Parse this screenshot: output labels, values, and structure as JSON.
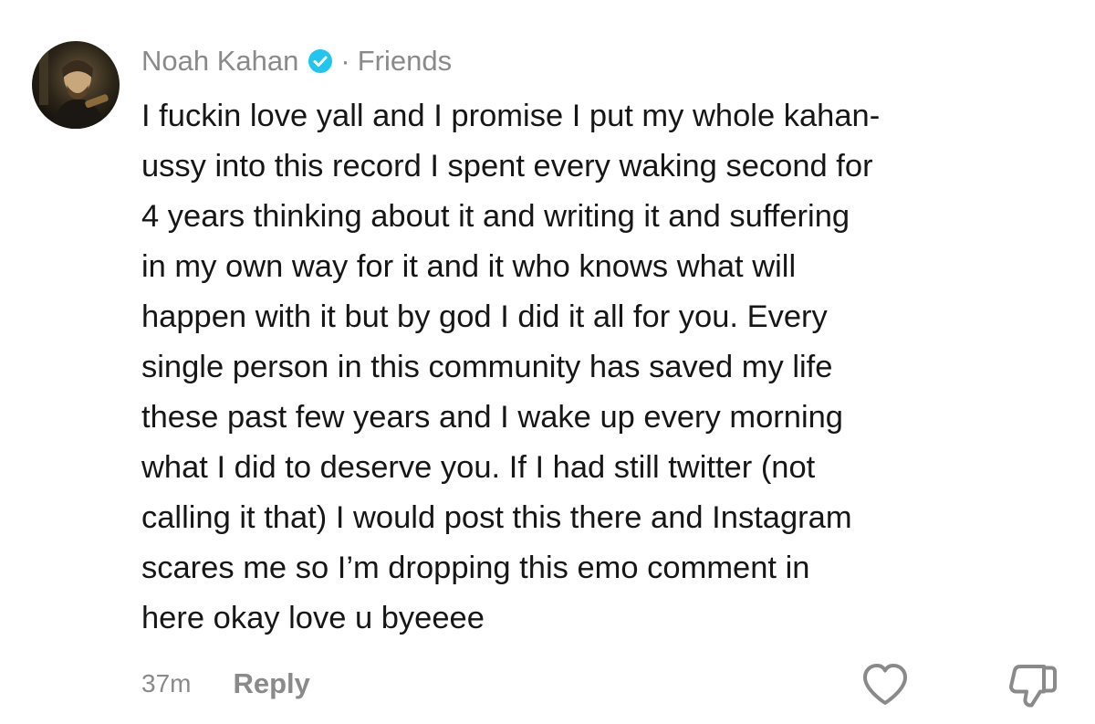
{
  "comment": {
    "author": "Noah Kahan",
    "separator": "·",
    "relation": "Friends",
    "verified_icon": "verified-badge-icon",
    "verified_color": "#20c6ee",
    "body_lines": [
      "I fuckin love yall and I promise I put my whole kahan-",
      "ussy into this record I spent every waking second for",
      "4 years thinking about it and writing it and suffering",
      "in my own way for it and it who knows what will",
      "happen with it but by god I did it all for you. Every",
      "single person in this community has saved my life",
      "these past few years and I wake up every morning",
      "what I did to deserve you. If I had still twitter (not",
      "calling it that) I would post this there and Instagram",
      "scares me so I’m dropping this emo comment in",
      "here okay love u byeeee"
    ],
    "time": "37m",
    "reply_label": "Reply",
    "like_icon": "heart-icon",
    "dislike_icon": "thumbs-down-icon"
  }
}
